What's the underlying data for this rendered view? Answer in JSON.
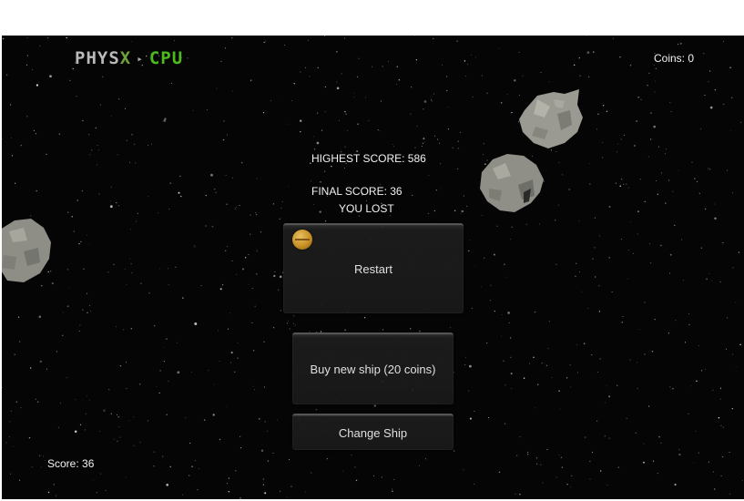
{
  "logo": {
    "part1": "PHYS",
    "part2": "X",
    "separator": "▸",
    "part3": "CPU"
  },
  "hud": {
    "coins": "Coins: 0",
    "score": "Score: 36"
  },
  "game_over": {
    "highest_score": "HIGHEST SCORE: 586",
    "final_score": "FINAL SCORE: 36",
    "result": "YOU LOST"
  },
  "buttons": {
    "restart": "Restart",
    "buy_ship": "Buy new ship (20 coins)",
    "change_ship": "Change Ship"
  },
  "icons": {
    "coin": "coin-icon"
  },
  "colors": {
    "background": "#050505",
    "asteroid": "#9a9a92",
    "logo_gray": "#b9b9b9",
    "logo_green": "#4bbb20",
    "coin": "#d89b26"
  }
}
